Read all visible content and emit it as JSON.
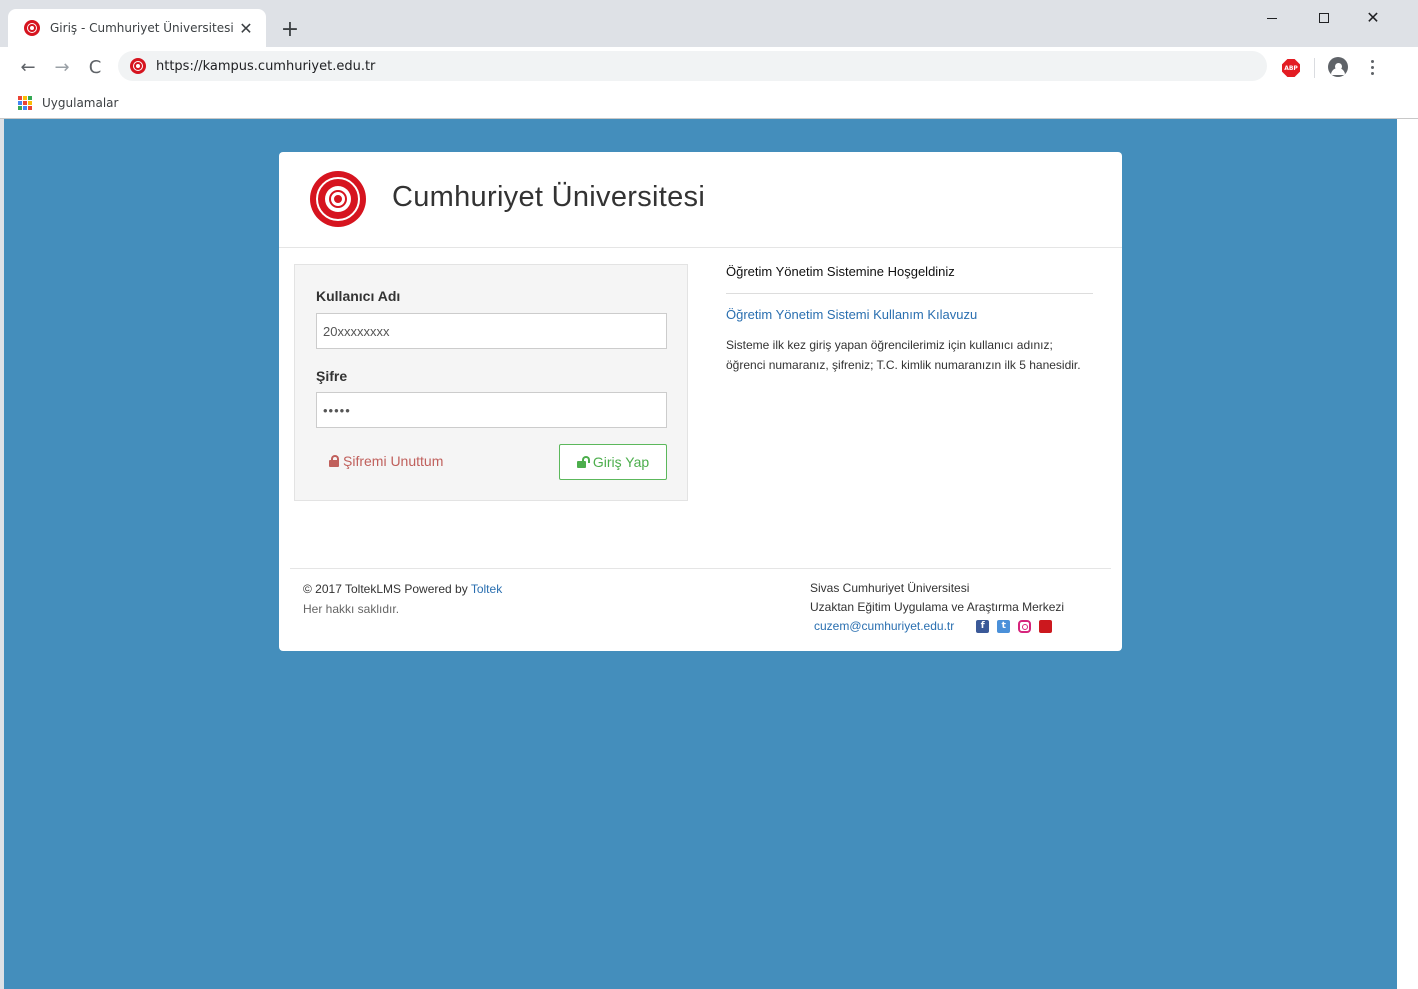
{
  "browser": {
    "tab_title": "Giriş - Cumhuriyet Üniversitesi",
    "tab_close": "✕",
    "new_tab": "+",
    "url": "https://kampus.cumhuriyet.edu.tr",
    "back": "←",
    "forward": "→",
    "reload": "C",
    "extension": "ABP",
    "close_window": "✕",
    "bookmarks": [
      {
        "label": "Uygulamalar",
        "icon": "apps-grid-icon"
      }
    ]
  },
  "header": {
    "university_name": "Cumhuriyet Üniversitesi",
    "logo_icon": "university-seal-icon"
  },
  "login": {
    "username_label": "Kullanıcı Adı",
    "username_value": "20xxxxxxxx",
    "password_label": "Şifre",
    "password_value": "•••••",
    "forgot_label": "Şifremi Unuttum",
    "submit_label": "Giriş Yap"
  },
  "info": {
    "title": "Öğretim Yönetim Sistemine Hoşgeldiniz",
    "guide_link": "Öğretim Yönetim Sistemi Kullanım Kılavuzu",
    "description": "Sisteme ilk kez giriş yapan öğrencilerimiz için kullanıcı adınız; öğrenci numaranız, şifreniz; T.C. kimlik numaranızın ilk 5 hanesidir."
  },
  "footer": {
    "copyright": "© 2017 ToltekLMS",
    "powered_by": " Powered by ",
    "vendor_link": "Toltek",
    "rights": "Her hakkı saklıdır.",
    "org_line1": "Sivas Cumhuriyet Üniversitesi",
    "org_line2": "Uzaktan Eğitim Uygulama ve Araştırma Merkezi",
    "email": "cuzem@cumhuriyet.edu.tr",
    "social": {
      "facebook": "f",
      "twitter": "t",
      "youtube": "You Tube"
    }
  },
  "colors": {
    "page_background": "#448ebc",
    "brand_red": "#d6141f",
    "link_blue": "#2a6fb0",
    "success_green": "#5cb85c",
    "danger_text": "#c0605c"
  }
}
